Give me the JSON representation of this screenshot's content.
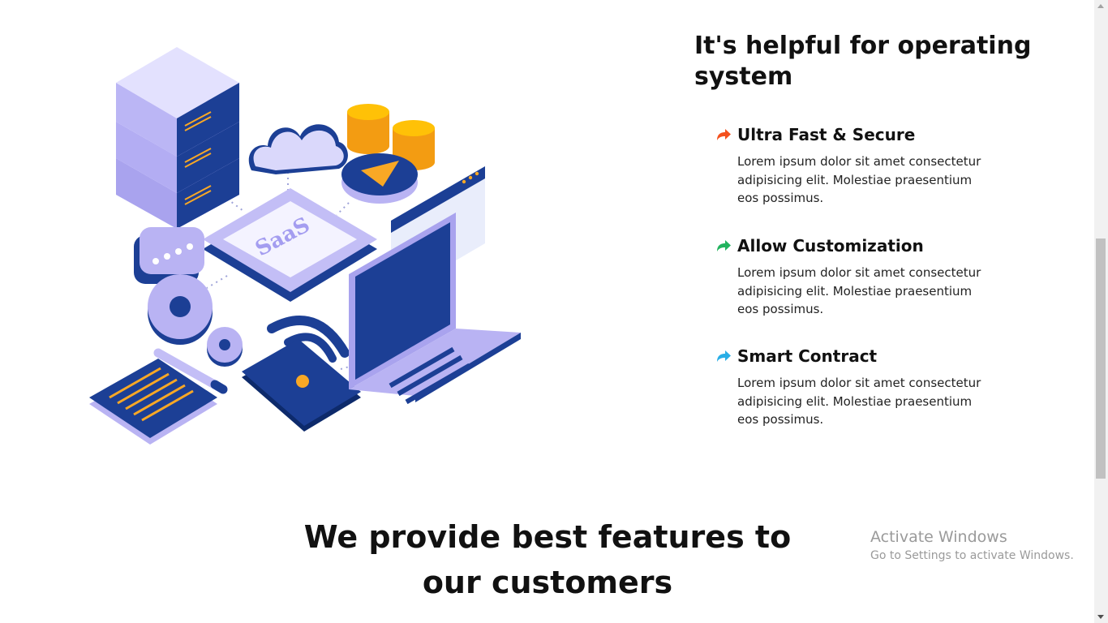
{
  "illustration": {
    "label": "SaaS",
    "colors": {
      "navy": "#1c3f95",
      "periwinkle": "#b9b3f3",
      "gold": "#f9a825"
    }
  },
  "section": {
    "title": "It's helpful for operating system",
    "features": [
      {
        "title": "Ultra Fast & Secure",
        "description": "Lorem ipsum dolor sit amet consectetur adipisicing elit. Molestiae praesentium eos possimus.",
        "icon": "share-arrow-icon",
        "color": "#f4511e"
      },
      {
        "title": "Allow Customization",
        "description": "Lorem ipsum dolor sit amet consectetur adipisicing elit. Molestiae praesentium eos possimus.",
        "icon": "share-arrow-icon",
        "color": "#22b35e"
      },
      {
        "title": "Smart Contract",
        "description": "Lorem ipsum dolor sit amet consectetur adipisicing elit. Molestiae praesentium eos possimus.",
        "icon": "share-arrow-icon",
        "color": "#29aee6"
      }
    ]
  },
  "features_heading": "We provide best features to our customers",
  "watermark": {
    "line1": "Activate Windows",
    "line2": "Go to Settings to activate Windows."
  }
}
